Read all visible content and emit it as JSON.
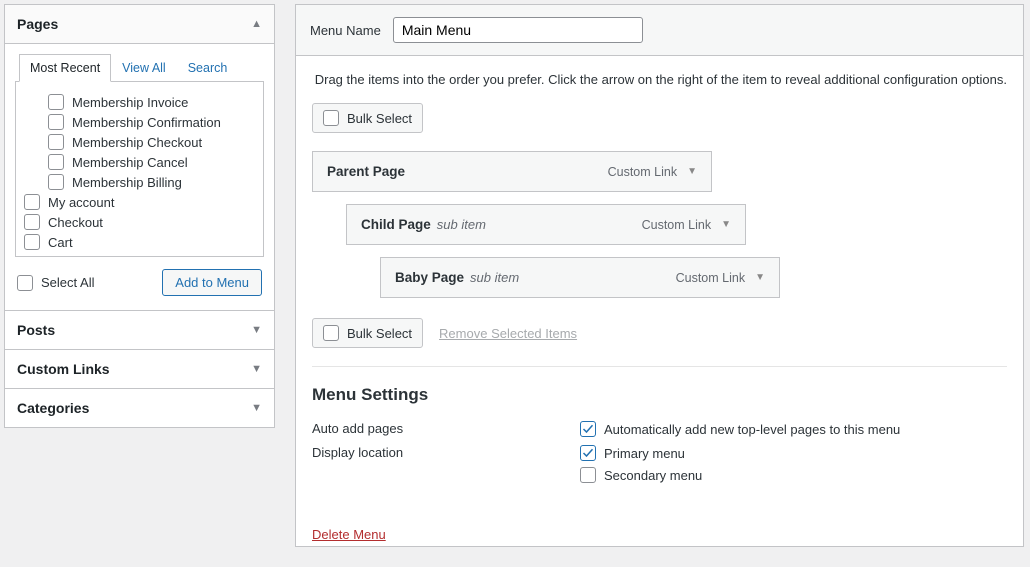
{
  "sidebar": {
    "pages": {
      "title": "Pages",
      "tabs": [
        "Most Recent",
        "View All",
        "Search"
      ],
      "items": [
        {
          "label": "Membership Invoice",
          "indent": true
        },
        {
          "label": "Membership Confirmation",
          "indent": true
        },
        {
          "label": "Membership Checkout",
          "indent": true
        },
        {
          "label": "Membership Cancel",
          "indent": true
        },
        {
          "label": "Membership Billing",
          "indent": true
        },
        {
          "label": "My account",
          "indent": false
        },
        {
          "label": "Checkout",
          "indent": false
        },
        {
          "label": "Cart",
          "indent": false
        }
      ],
      "select_all": "Select All",
      "add_button": "Add to Menu"
    },
    "posts_title": "Posts",
    "custom_links_title": "Custom Links",
    "categories_title": "Categories"
  },
  "main": {
    "menu_name_label": "Menu Name",
    "menu_name_value": "Main Menu",
    "intro": "Drag the items into the order you prefer. Click the arrow on the right of the item to reveal additional configuration options.",
    "bulk_select": "Bulk Select",
    "remove_selected": "Remove Selected Items",
    "items": [
      {
        "label": "Parent Page",
        "sub": "",
        "type": "Custom Link",
        "level": 0
      },
      {
        "label": "Child Page",
        "sub": "sub item",
        "type": "Custom Link",
        "level": 1
      },
      {
        "label": "Baby Page",
        "sub": "sub item",
        "type": "Custom Link",
        "level": 2
      }
    ],
    "settings": {
      "heading": "Menu Settings",
      "auto_add_label": "Auto add pages",
      "auto_add_option": "Automatically add new top-level pages to this menu",
      "display_label": "Display location",
      "primary": "Primary menu",
      "secondary": "Secondary menu"
    },
    "delete": "Delete Menu"
  }
}
